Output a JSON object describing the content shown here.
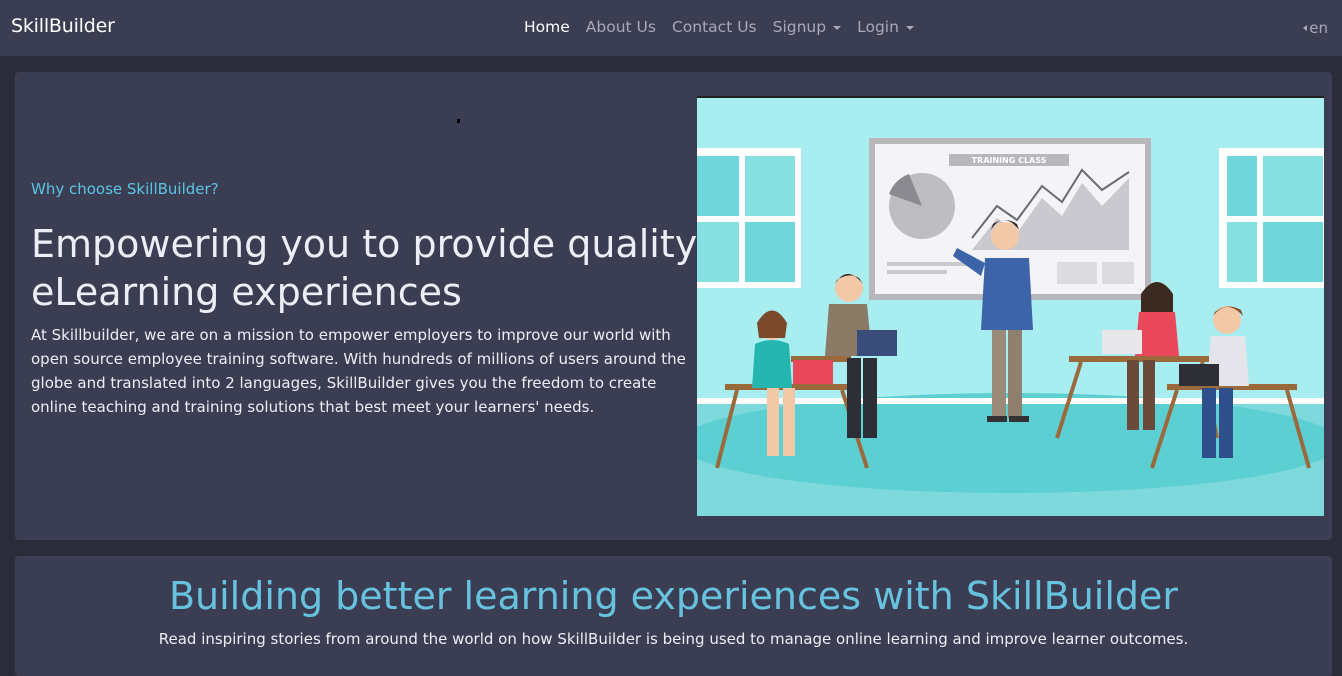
{
  "navbar": {
    "brand": "SkillBuilder",
    "links": [
      {
        "label": "Home",
        "active": true
      },
      {
        "label": "About Us"
      },
      {
        "label": "Contact Us"
      },
      {
        "label": "Signup",
        "dropdown": true
      },
      {
        "label": "Login",
        "dropdown": true
      }
    ],
    "language": "en"
  },
  "hero": {
    "eyebrow": "Why choose SkillBuilder?",
    "title": "Empowering you to provide quality eLearning experiences",
    "text": "At Skillbuilder, we are on a mission to empower employers to improve our world with open source employee training software. With hundreds of millions of users around the globe and translated into 2 languages, SkillBuilder gives you the freedom to create online teaching and training solutions that best meet your learners' needs.",
    "image": {
      "board_label": "TRAINING CLASS"
    }
  },
  "section": {
    "title": "Building better learning experiences with SkillBuilder",
    "subtitle": "Read inspiring stories from around the world on how SkillBuilder is being used to manage online learning and improve learner outcomes."
  },
  "colors": {
    "navbar_bg": "#3b3e52",
    "page_bg": "#2b2c3a",
    "accent": "#5bc4e3",
    "image_bg": "#a8eef1"
  }
}
